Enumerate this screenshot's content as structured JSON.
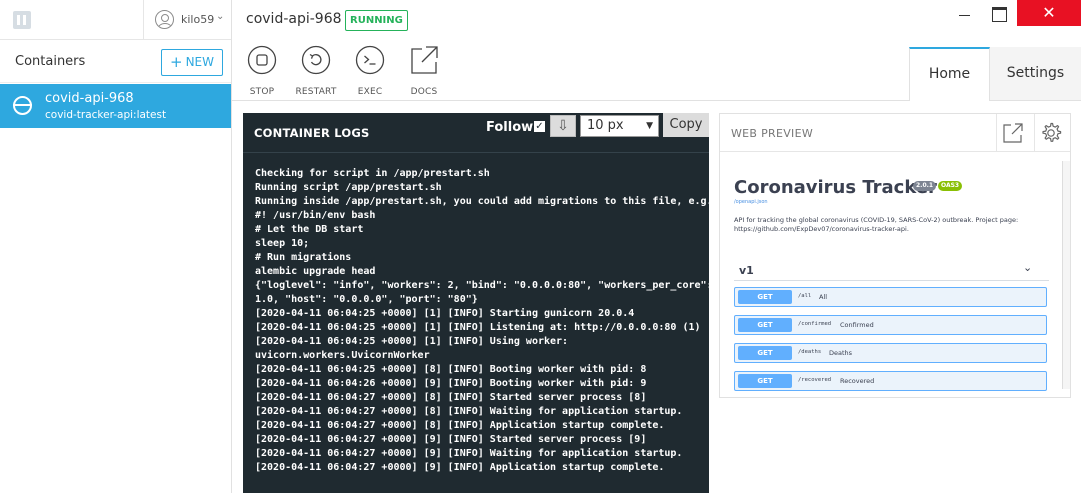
{
  "user": {
    "name": "kilo59"
  },
  "sidebar": {
    "title": "Containers",
    "new_label": "NEW",
    "containers": [
      {
        "name": "covid-api-968",
        "image": "covid-tracker-api:latest"
      }
    ]
  },
  "container": {
    "name": "covid-api-968",
    "status": "RUNNING"
  },
  "toolbar": {
    "stop": "STOP",
    "restart": "RESTART",
    "exec": "EXEC",
    "docs": "DOCS"
  },
  "tabs": {
    "home": "Home",
    "settings": "Settings"
  },
  "logs": {
    "title": "CONTAINER LOGS",
    "follow_label": "Follow",
    "follow_checked": true,
    "font_size": "10 px",
    "copy_label": "Copy",
    "lines": [
      "Checking for script in /app/prestart.sh",
      "Running script /app/prestart.sh",
      "Running inside /app/prestart.sh, you could add migrations to this file, e.g.:",
      "#! /usr/bin/env bash",
      "# Let the DB start",
      "sleep 10;",
      "# Run migrations",
      "alembic upgrade head",
      "{\"loglevel\": \"info\", \"workers\": 2, \"bind\": \"0.0.0.0:80\", \"workers_per_core\":",
      "1.0, \"host\": \"0.0.0.0\", \"port\": \"80\"}",
      "[2020-04-11 06:04:25 +0000] [1] [INFO] Starting gunicorn 20.0.4",
      "[2020-04-11 06:04:25 +0000] [1] [INFO] Listening at: http://0.0.0.0:80 (1)",
      "[2020-04-11 06:04:25 +0000] [1] [INFO] Using worker:",
      "uvicorn.workers.UvicornWorker",
      "[2020-04-11 06:04:25 +0000] [8] [INFO] Booting worker with pid: 8",
      "[2020-04-11 06:04:26 +0000] [9] [INFO] Booting worker with pid: 9",
      "[2020-04-11 06:04:27 +0000] [8] [INFO] Started server process [8]",
      "[2020-04-11 06:04:27 +0000] [8] [INFO] Waiting for application startup.",
      "[2020-04-11 06:04:27 +0000] [8] [INFO] Application startup complete.",
      "[2020-04-11 06:04:27 +0000] [9] [INFO] Started server process [9]",
      "[2020-04-11 06:04:27 +0000] [9] [INFO] Waiting for application startup.",
      "[2020-04-11 06:04:27 +0000] [9] [INFO] Application startup complete."
    ]
  },
  "preview": {
    "title": "WEB PREVIEW",
    "api_title": "Coronavirus Tracker",
    "version": "2.0.1",
    "oas": "OAS3",
    "spec_link": "/openapi.json",
    "description": "API for tracking the global coronavirus (COVID-19, SARS-CoV-2) outbreak. Project page: https://github.com/ExpDev07/coronavirus-tracker-api.",
    "group": "v1",
    "operations": [
      {
        "method": "GET",
        "path": "/all",
        "desc": "All"
      },
      {
        "method": "GET",
        "path": "/confirmed",
        "desc": "Confirmed"
      },
      {
        "method": "GET",
        "path": "/deaths",
        "desc": "Deaths"
      },
      {
        "method": "GET",
        "path": "/recovered",
        "desc": "Recovered"
      }
    ]
  },
  "colors": {
    "accent": "#2ea8df",
    "running": "#25b25a",
    "logs_bg": "#1f2a30",
    "close": "#e81123",
    "get_method": "#61affe"
  }
}
